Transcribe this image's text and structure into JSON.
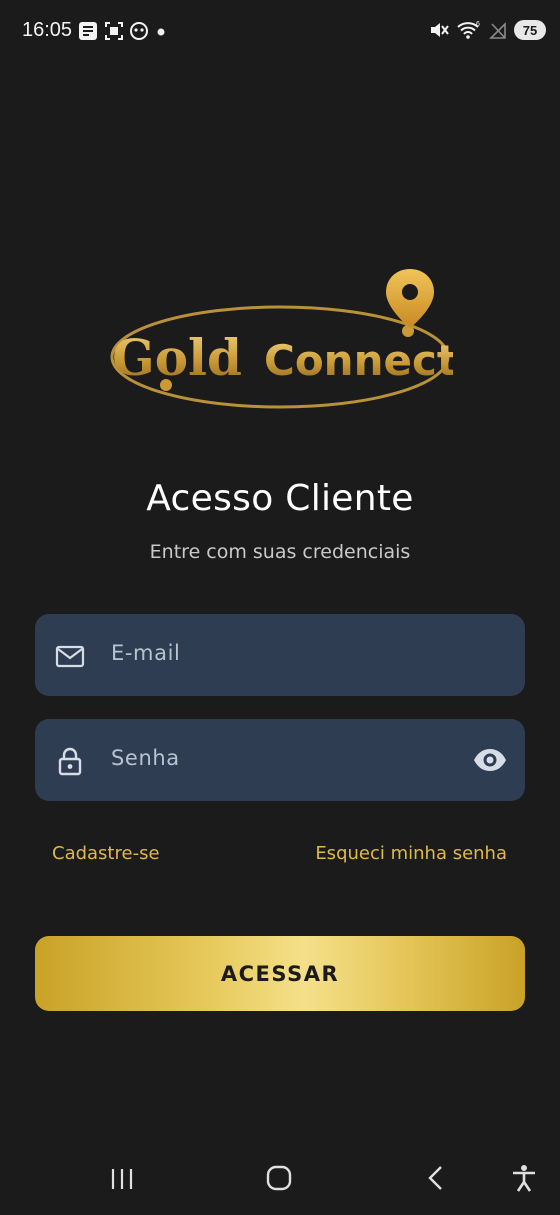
{
  "status_bar": {
    "time": "16:05",
    "battery": "75"
  },
  "logo": {
    "word1": "Gold",
    "word2": "Connect"
  },
  "login": {
    "title": "Acesso Cliente",
    "subtitle": "Entre com suas credenciais",
    "email_placeholder": "E-mail",
    "password_placeholder": "Senha",
    "signup_link": "Cadastre-se",
    "forgot_link": "Esqueci minha senha",
    "submit_label": "ACESSAR"
  },
  "colors": {
    "background": "#1b1b1b",
    "field_background": "#2e3d52",
    "accent_gold": "#e0b94b"
  },
  "icons": {
    "email": "mail-icon",
    "password": "lock-icon",
    "visibility": "eye-icon",
    "nav_recent": "recent-apps-icon",
    "nav_home": "home-icon",
    "nav_back": "back-icon",
    "accessibility": "accessibility-icon"
  }
}
